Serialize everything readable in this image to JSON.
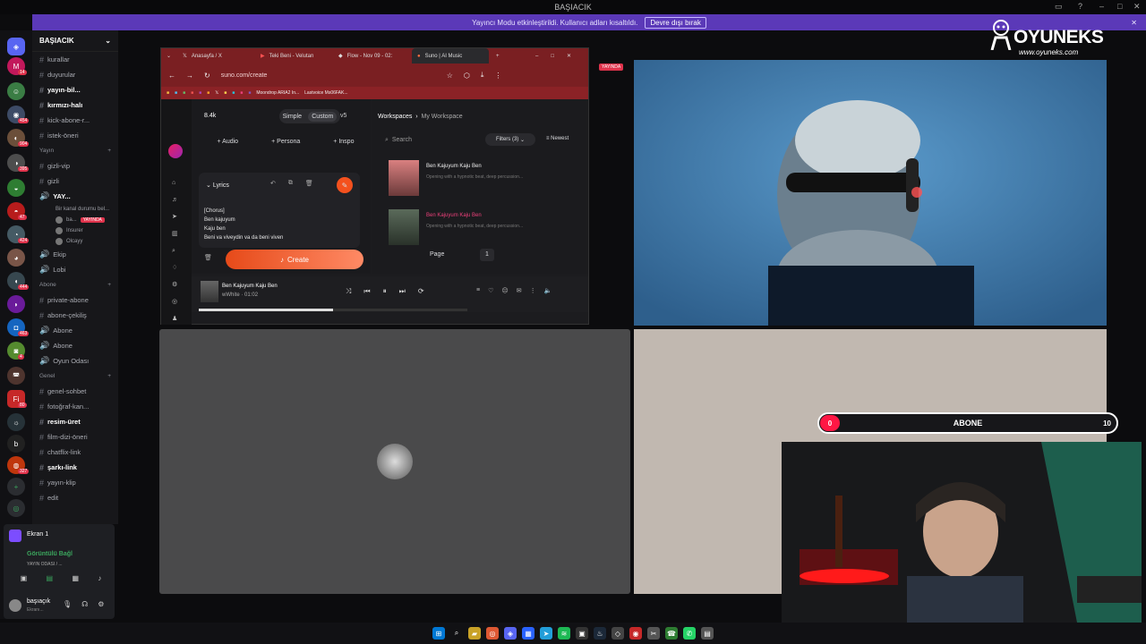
{
  "titlebar": {
    "title": "BAŞIACIK"
  },
  "banner": {
    "text": "Yayıncı Modu etkinleştirildi. Kullanıcı adları kısaltıldı.",
    "button": "Devre dışı bırak"
  },
  "logo": {
    "name": "OYUNEKS",
    "url": "www.oyuneks.com"
  },
  "rail": {
    "badges": [
      "14",
      "454",
      "904",
      "395",
      "47",
      "424",
      "444",
      "463",
      "4",
      "80",
      "327"
    ]
  },
  "server": {
    "name": "BAŞIACIK"
  },
  "channels": [
    {
      "label": "kurallar",
      "type": "#"
    },
    {
      "label": "duyurular",
      "type": "#"
    },
    {
      "label": "yayın-bil...",
      "type": "#",
      "bold": true
    },
    {
      "label": "kırmızı-halı",
      "type": "#",
      "bold": true
    },
    {
      "label": "kick-abone-r...",
      "type": "#"
    },
    {
      "label": "istek-öneri",
      "type": "#"
    }
  ],
  "cat_yayin": "Yayın",
  "channels2": [
    {
      "label": "gizli-vip",
      "type": "#"
    },
    {
      "label": "gizli",
      "type": "#"
    },
    {
      "label": "YAY...",
      "type": "🔊",
      "bold": true
    }
  ],
  "voice_sub": "Bir kanal durumu bel...",
  "voice_users": [
    {
      "name": "ba...",
      "live": "YAYINDA"
    },
    {
      "name": "Insurer"
    },
    {
      "name": "Olcayy"
    }
  ],
  "channels3": [
    {
      "label": "Ekip",
      "type": "🔊"
    },
    {
      "label": "Lobi",
      "type": "🔊"
    }
  ],
  "cat_abone": "Abone",
  "channels4": [
    {
      "label": "private-abone",
      "type": "#"
    },
    {
      "label": "abone-çekiliş",
      "type": "#"
    },
    {
      "label": "Abone",
      "type": "🔊"
    },
    {
      "label": "Abone",
      "type": "🔊"
    },
    {
      "label": "Oyun Odası",
      "type": "🔊"
    }
  ],
  "cat_genel": "Genel",
  "channels5": [
    {
      "label": "genel-sohbet",
      "type": "#"
    },
    {
      "label": "fotoğraf-kan...",
      "type": "#"
    },
    {
      "label": "resim-üret",
      "type": "#",
      "bold": true
    },
    {
      "label": "film-dizi-öneri",
      "type": "#"
    },
    {
      "label": "chatflix-link",
      "type": "#"
    },
    {
      "label": "şarkı-link",
      "type": "#",
      "bold": true
    },
    {
      "label": "yayın-klip",
      "type": "#"
    },
    {
      "label": "edit",
      "type": "#"
    }
  ],
  "voicepanel": {
    "screen": "Ekran 1",
    "status": "Görüntülü Bağl",
    "sub": "YAYIN ODASI / ...",
    "user": "başıaçık",
    "user_sub": "Ekranı..."
  },
  "browser": {
    "tabs": [
      "Anasayfa / X",
      "Teki Beni - Velutan",
      "Flow - Nov 09 - 02:",
      "Suno | AI Music"
    ],
    "url": "suno.com/create",
    "bookmarks": [
      "Moondrop ARIA2 In...",
      "Lastvoice Ms06FAK..."
    ],
    "credits": "8.4k",
    "mode_simple": "Simple",
    "mode_custom": "Custom",
    "version": "v5",
    "btn_audio": "Audio",
    "btn_persona": "Persona",
    "btn_inspo": "Inspo",
    "lyrics_label": "Lyrics",
    "lyrics": [
      "[Chorus]",
      "Ben kajuyum",
      "Kaju ben",
      "Beni va viveydin va da beni viven"
    ],
    "create": "Create",
    "workspaces": "Workspaces",
    "my_workspace": "My Workspace",
    "search": "Search",
    "filters": "Filters (3)",
    "sort": "Newest",
    "songs": [
      {
        "title": "Ben Kajuyum Kaju Ben",
        "desc": "Opening with a hypnotic beat, deep percussion..."
      },
      {
        "title": "Ben Kajuyum Kaju Ben",
        "desc": "Opening with a hypnotic beat, deep percussion..."
      }
    ],
    "page_label": "Page",
    "page": "1",
    "player_title": "Ben Kajuyum Kaju Ben",
    "player_artist": "wWhite",
    "player_time": "01:02",
    "player_progress": 0.5,
    "live_tag": "YAYINDA"
  },
  "abone": {
    "label": "ABONE",
    "current": "0",
    "goal": "10"
  }
}
